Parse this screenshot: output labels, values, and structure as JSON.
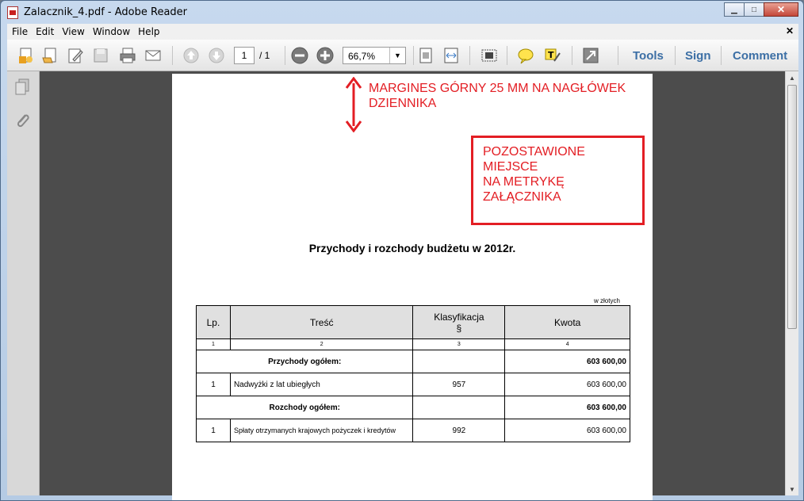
{
  "window": {
    "title": "Zalacznik_4.pdf - Adobe Reader"
  },
  "menu": [
    "File",
    "Edit",
    "View",
    "Window",
    "Help"
  ],
  "toolbar": {
    "page_current": "1",
    "page_total": "/ 1",
    "zoom": "66,7%",
    "tools_label": "Tools",
    "sign_label": "Sign",
    "comment_label": "Comment"
  },
  "document": {
    "margin_note": [
      "MARGINES GÓRNY 25 MM NA NAGŁÓWEK",
      "DZIENNIKA"
    ],
    "metryka_note": [
      "POZOSTAWIONE MIEJSCE",
      "NA METRYKĘ",
      "ZAŁĄCZNIKA"
    ],
    "title": "Przychody i rozchody budżetu w 2012r.",
    "unit_note": "w złotych",
    "table": {
      "headers": [
        "Lp.",
        "Treść",
        "Klasyfikacja",
        "§",
        "Kwota"
      ],
      "col_numbers": [
        "1",
        "2",
        "3",
        "4"
      ],
      "rows": [
        {
          "lp": "",
          "tresc": "Przychody ogółem:",
          "klas": "",
          "kwota": "603 600,00"
        },
        {
          "lp": "1",
          "tresc": "Nadwyżki z lat ubiegłych",
          "klas": "957",
          "kwota": "603 600,00"
        },
        {
          "lp": "",
          "tresc": "Rozchody ogółem:",
          "klas": "",
          "kwota": "603 600,00"
        },
        {
          "lp": "1",
          "tresc": "Spłaty otrzymanych krajowych pożyczek i kredytów",
          "klas": "992",
          "kwota": "603 600,00"
        }
      ]
    }
  }
}
